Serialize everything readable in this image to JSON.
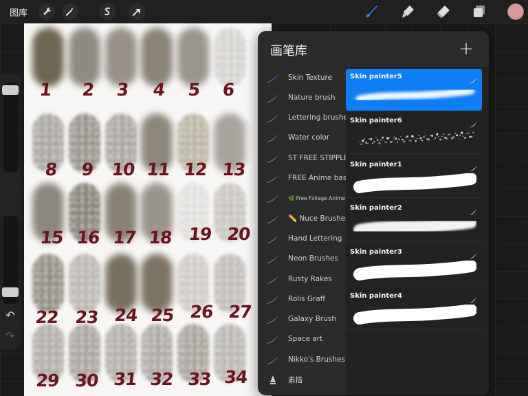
{
  "toolbar": {
    "gallery_label": "图库",
    "left_tools": [
      "wrench-icon",
      "magic-wand-icon",
      "selection-icon",
      "transform-arrow-icon"
    ],
    "right_tools": [
      "brush-icon",
      "smudge-icon",
      "eraser-icon",
      "layers-icon"
    ],
    "active_tool": "brush-icon",
    "accent_color": "#1f8cff",
    "current_color": "#d79b98"
  },
  "sidebar": {
    "brush_size_level": 0.05,
    "opacity_level": 0.05,
    "undo_icon": "undo-icon",
    "redo_icon": "redo-icon"
  },
  "canvas": {
    "labels": [
      "1",
      "2",
      "3",
      "4",
      "5",
      "6",
      "8",
      "9",
      "10",
      "11",
      "12",
      "13",
      "15",
      "16",
      "17",
      "18",
      "19",
      "20",
      "22",
      "23",
      "24",
      "25",
      "26",
      "27",
      "29",
      "30",
      "31",
      "32",
      "33",
      "34"
    ],
    "ink_color": "#6b1420"
  },
  "brush_library": {
    "title": "画笔库",
    "add_icon": "plus-icon",
    "sets": [
      {
        "label": "Skin Texture",
        "icon": "brush-stroke-icon",
        "active": true
      },
      {
        "label": "Nature brush",
        "icon": "brush-stroke-icon"
      },
      {
        "label": "Lettering brushes",
        "icon": "brush-stroke-icon"
      },
      {
        "label": "Water color",
        "icon": "brush-stroke-icon"
      },
      {
        "label": "ST FREE STIPPLE",
        "icon": "brush-stroke-icon"
      },
      {
        "label": "FREE Anime basic",
        "icon": "brush-stroke-icon"
      },
      {
        "label": "🌿 Free Foliage Anime",
        "icon": "brush-stroke-icon",
        "small": true
      },
      {
        "label": "✏️ Nuce Brushes",
        "icon": "brush-stroke-icon"
      },
      {
        "label": "Hand Lettering",
        "icon": "brush-stroke-icon"
      },
      {
        "label": "Neon Brushes",
        "icon": "brush-stroke-icon"
      },
      {
        "label": "Rusty Rakes",
        "icon": "brush-stroke-icon"
      },
      {
        "label": "Rolis Graff",
        "icon": "brush-stroke-icon"
      },
      {
        "label": "Galaxy Brush",
        "icon": "brush-stroke-icon"
      },
      {
        "label": "Space art",
        "icon": "brush-stroke-icon"
      },
      {
        "label": "Nikko's Brushes",
        "icon": "brush-stroke-icon"
      },
      {
        "label": "素描",
        "icon": "pencil-nib-icon"
      }
    ],
    "brushes": [
      {
        "name": "Skin painter5",
        "style": "airbrush",
        "selected": true
      },
      {
        "name": "Skin painter6",
        "style": "speckle"
      },
      {
        "name": "Skin painter1",
        "style": "solid"
      },
      {
        "name": "Skin painter2",
        "style": "soft"
      },
      {
        "name": "Skin painter3",
        "style": "solid"
      },
      {
        "name": "Skin painter4",
        "style": "solid"
      }
    ]
  }
}
